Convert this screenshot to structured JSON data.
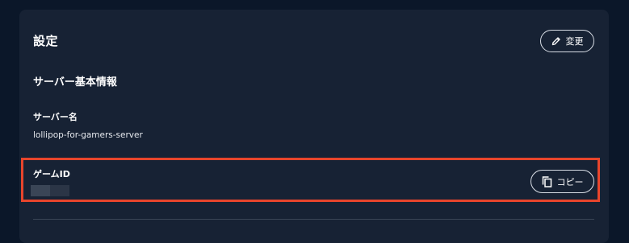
{
  "card": {
    "title": "設定"
  },
  "edit_button": {
    "label": "変更",
    "icon": "pencil-icon"
  },
  "section": {
    "heading": "サーバー基本情報"
  },
  "server_name": {
    "label": "サーバー名",
    "value": "lollipop-for-gamers-server"
  },
  "game_id": {
    "label": "ゲームID",
    "value_masked": true
  },
  "copy_button": {
    "label": "コピー",
    "icon": "copy-icon"
  },
  "colors": {
    "background": "#0b1729",
    "card": "#172234",
    "highlight": "#e8452c",
    "button_border": "#d8dde5"
  }
}
